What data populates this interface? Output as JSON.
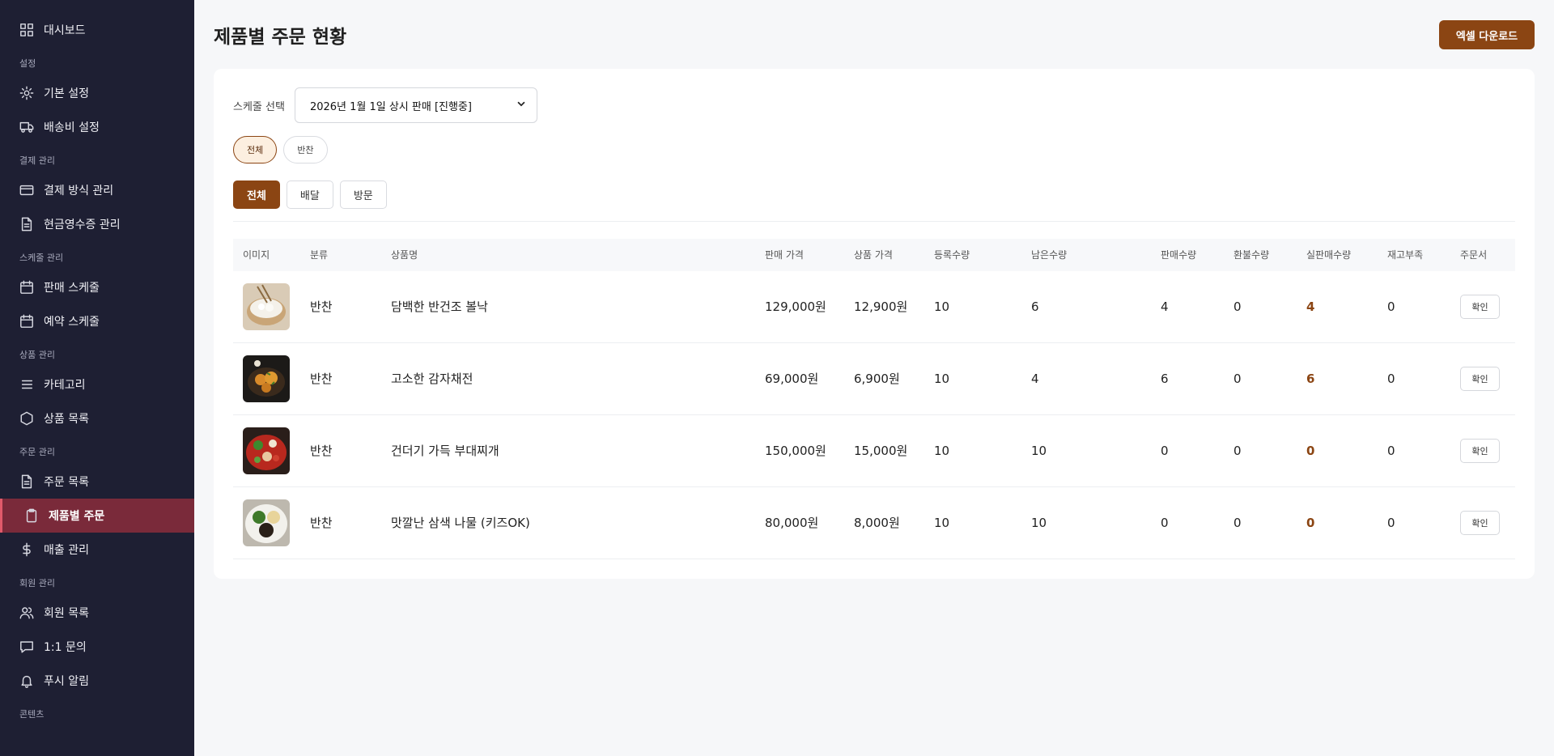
{
  "sidebar": {
    "dashboard": "대시보드",
    "sections": {
      "settings": "설정",
      "payment": "결제 관리",
      "schedule": "스케줄 관리",
      "product": "상품 관리",
      "order": "주문 관리",
      "member": "회원 관리",
      "content": "콘텐츠"
    },
    "items": {
      "basic_settings": "기본 설정",
      "shipping_settings": "배송비 설정",
      "payment_methods": "결제 방식 관리",
      "cash_receipt": "현금영수증 관리",
      "sales_schedule": "판매 스케줄",
      "reservation_schedule": "예약 스케줄",
      "category": "카테고리",
      "product_list": "상품 목록",
      "order_list": "주문 목록",
      "product_orders": "제품별 주문",
      "sales_management": "매출 관리",
      "member_list": "회원 목록",
      "inquiry": "1:1 문의",
      "push": "푸시 알림"
    }
  },
  "header": {
    "title": "제품별 주문 현황",
    "excel_button": "엑셀 다운로드"
  },
  "filters": {
    "schedule_label": "스케줄 선택",
    "schedule_value": "2026년 1월 1일 상시 판매 [진행중]",
    "categories": [
      "전체",
      "반찬"
    ],
    "active_category": "전체",
    "types": [
      "전체",
      "배달",
      "방문"
    ],
    "active_type": "전체"
  },
  "table": {
    "columns": [
      "이미지",
      "분류",
      "상품명",
      "판매 가격",
      "상품 가격",
      "등록수량",
      "남은수량",
      "판매수량",
      "환불수량",
      "실판매수량",
      "재고부족",
      "주문서"
    ],
    "rows": [
      {
        "category": "반찬",
        "name": "담백한 반건조 볼낙",
        "sale_price": "129,000원",
        "product_price": "12,900원",
        "registered": "10",
        "remaining": "6",
        "sold": "4",
        "refunded": "0",
        "real_sold": "4",
        "shortage": "0",
        "action": "확인"
      },
      {
        "category": "반찬",
        "name": "고소한 감자채전",
        "sale_price": "69,000원",
        "product_price": "6,900원",
        "registered": "10",
        "remaining": "4",
        "sold": "6",
        "refunded": "0",
        "real_sold": "6",
        "shortage": "0",
        "action": "확인"
      },
      {
        "category": "반찬",
        "name": "건더기 가득 부대찌개",
        "sale_price": "150,000원",
        "product_price": "15,000원",
        "registered": "10",
        "remaining": "10",
        "sold": "0",
        "refunded": "0",
        "real_sold": "0",
        "shortage": "0",
        "action": "확인"
      },
      {
        "category": "반찬",
        "name": "맛깔난 삼색 나물 (키즈OK)",
        "sale_price": "80,000원",
        "product_price": "8,000원",
        "registered": "10",
        "remaining": "10",
        "sold": "0",
        "refunded": "0",
        "real_sold": "0",
        "shortage": "0",
        "action": "확인"
      }
    ]
  },
  "colors": {
    "sidebar_bg": "#1e1f33",
    "active_item_bg": "#7a2a3a",
    "accent": "#8b4513"
  }
}
